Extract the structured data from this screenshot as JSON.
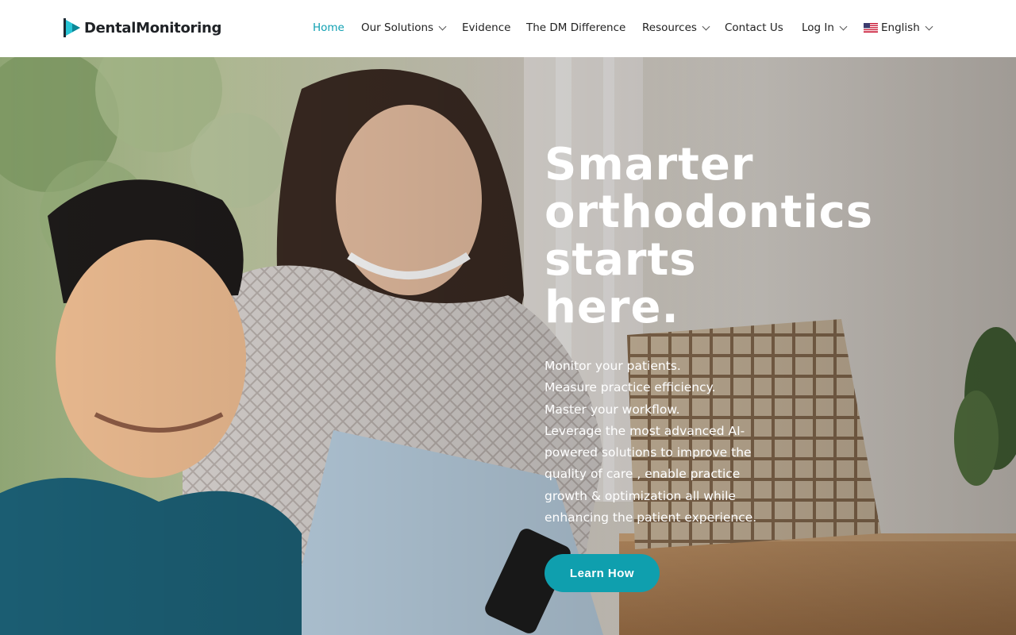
{
  "brand": {
    "name": "DentalMonitoring",
    "accent": "#10a0b2"
  },
  "nav": {
    "items": [
      {
        "label": "Home",
        "active": true
      },
      {
        "label": "Our Solutions",
        "dropdown": true
      },
      {
        "label": "Evidence"
      },
      {
        "label": "The DM Difference"
      },
      {
        "label": "Resources",
        "dropdown": true
      },
      {
        "label": "Contact Us"
      },
      {
        "label": "Log In",
        "dropdown": true
      }
    ],
    "language": {
      "label": "English",
      "flag_icon": "us-flag-icon"
    }
  },
  "hero": {
    "title_lines": [
      "Smarter",
      "orthodontics",
      "starts",
      "here."
    ],
    "copy_lines": [
      "Monitor your patients.",
      "Measure practice efficiency.",
      "Master your workflow.",
      "Leverage the most advanced AI-powered solutions to improve the quality of care , enable practice growth & optimization all while enhancing the patient experience."
    ],
    "cta_label": "Learn How",
    "cta_color": "#0f9fae"
  }
}
